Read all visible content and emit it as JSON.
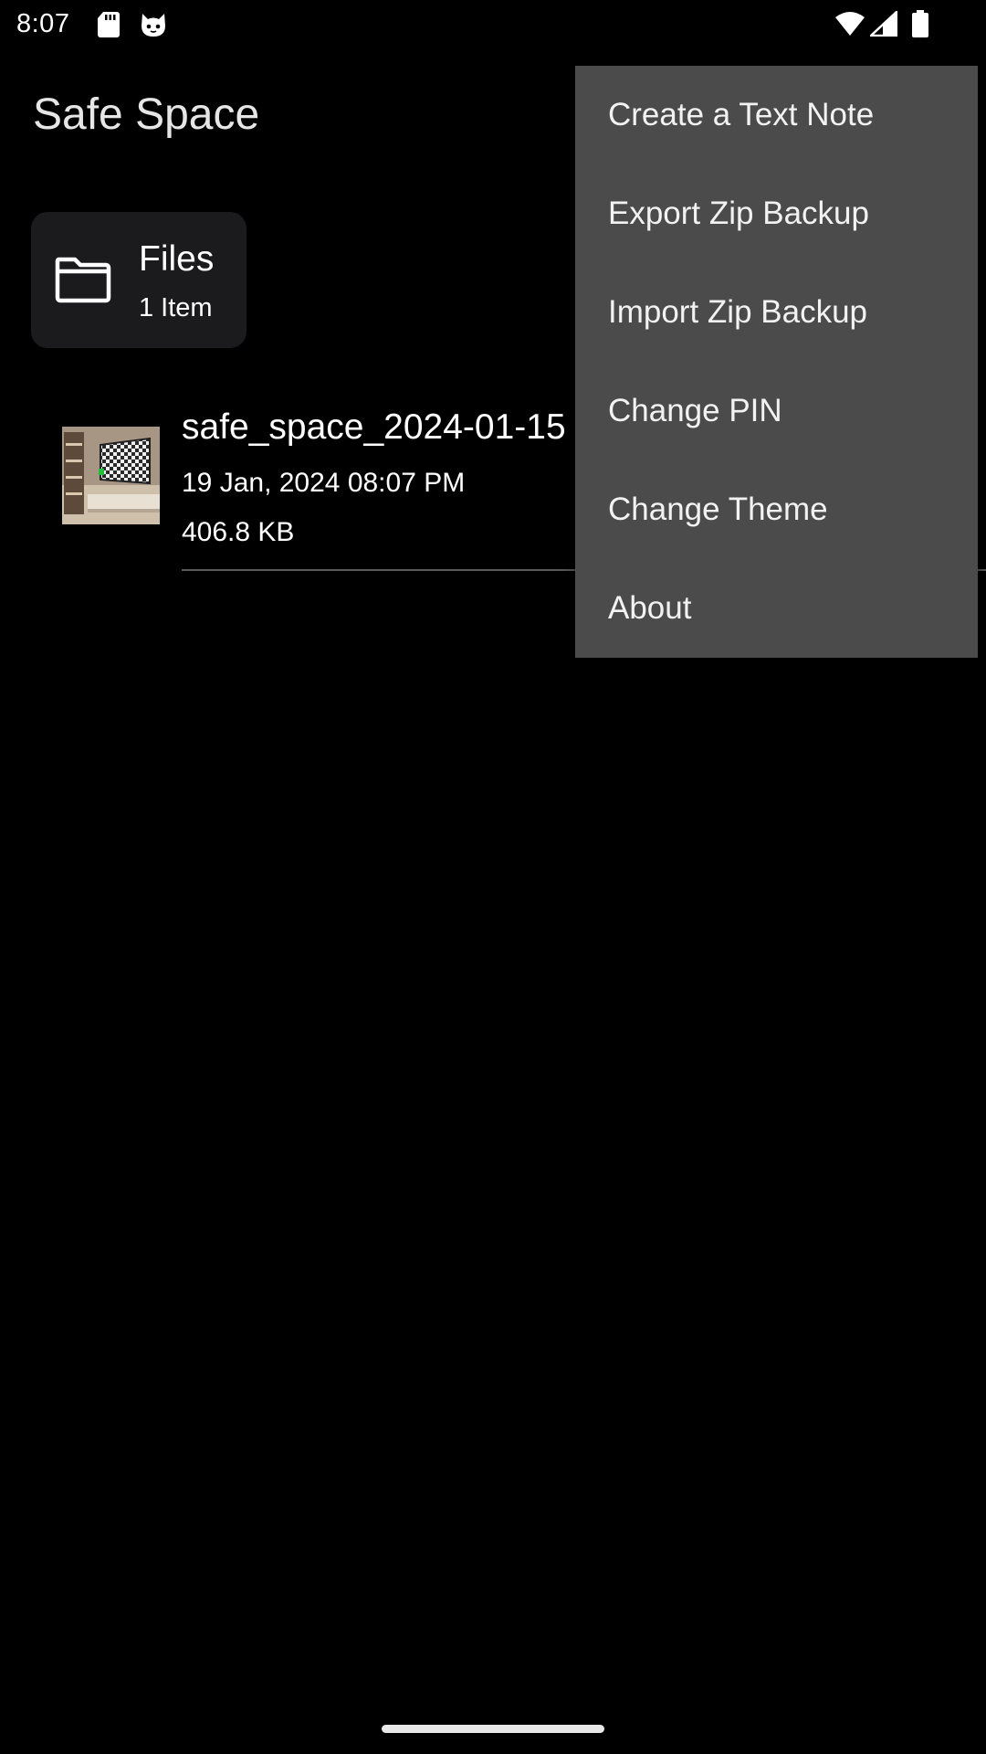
{
  "status_bar": {
    "time": "8:07",
    "icons": [
      "sd-card-icon",
      "cat-notification-icon",
      "wifi-icon",
      "signal-icon",
      "battery-icon"
    ]
  },
  "app_bar": {
    "title": "Safe Space"
  },
  "folder_card": {
    "name": "Files",
    "count": "1 Item",
    "icon": "folder-icon"
  },
  "file_item": {
    "name": "safe_space_2024-01-15",
    "date": "19 Jan, 2024 08:07 PM",
    "size": "406.8 KB",
    "thumbnail": "image-thumbnail"
  },
  "overflow_menu": {
    "items": [
      {
        "label": "Create a Text Note"
      },
      {
        "label": "Export Zip Backup"
      },
      {
        "label": "Import Zip Backup"
      },
      {
        "label": "Change PIN"
      },
      {
        "label": "Change Theme"
      },
      {
        "label": "About"
      }
    ]
  },
  "colors": {
    "background": "#000000",
    "card": "#1b1b1e",
    "menu": "#4b4b4b",
    "divider": "#5a5a5a"
  }
}
